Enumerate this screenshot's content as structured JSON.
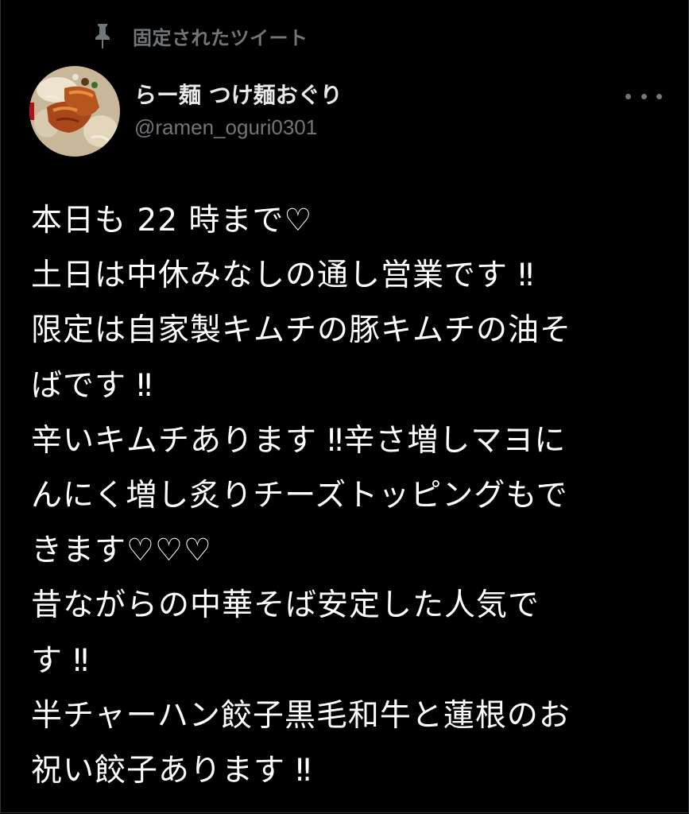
{
  "pinned": {
    "label": "固定されたツイート",
    "icon": "pin-icon"
  },
  "author": {
    "display_name": "らー麺 つけ麺おぐり",
    "handle": "@ramen_oguri0301",
    "avatar": "avatar-food-image"
  },
  "more": {
    "icon": "more-horizontal-icon"
  },
  "tweet": {
    "lines": [
      "本日も 22 時まで♡",
      "土日は中休みなしの通し営業です ‼︎",
      "限定は自家製キムチの豚キムチの油そ",
      "ばです ‼︎",
      "辛いキムチあります ‼︎辛さ増しマヨに",
      "んにく増し炙りチーズトッピングもで",
      "きます♡♡♡",
      "昔ながらの中華そば安定した人気で",
      "す ‼︎",
      "半チャーハン餃子黒毛和牛と蓮根のお",
      "祝い餃子あります ‼︎"
    ]
  },
  "colors": {
    "background": "#000000",
    "text_primary": "#ffffff",
    "text_secondary": "#71767b"
  }
}
